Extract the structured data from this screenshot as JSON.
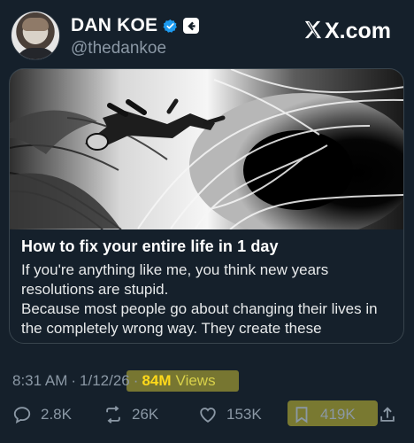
{
  "author": {
    "display_name": "DAN KOE",
    "handle": "@thedankoe",
    "verified_badge_color": "#1d9bf0",
    "avatar_icon": "profile-photo"
  },
  "site": {
    "label": "X.com",
    "logo_icon": "x-logo"
  },
  "card": {
    "title": "How to fix your entire life in 1 day",
    "description_lines": [
      "If you're anything like me, you think new years",
      "resolutions are stupid.",
      "Because most people go about changing their lives in",
      "the completely wrong way. They create these"
    ],
    "image_subject": "astronaut falling into a vortex"
  },
  "meta": {
    "time": "8:31 AM",
    "separator_1": "·",
    "date": "1/12/26",
    "separator_2": "·",
    "views_count": "84M",
    "views_label": "Views",
    "highlight_color": "#ffee3a"
  },
  "actions": {
    "reply_count": "2.8K",
    "repost_count": "26K",
    "like_count": "153K",
    "bookmark_count": "419K",
    "reply_icon": "reply-icon",
    "repost_icon": "repost-icon",
    "like_icon": "heart-icon",
    "bookmark_icon": "bookmark-icon",
    "share_icon": "share-icon"
  }
}
